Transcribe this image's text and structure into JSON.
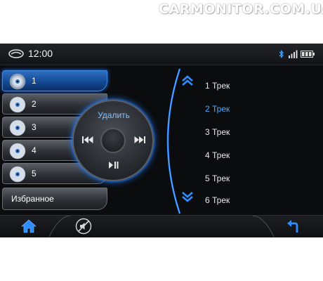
{
  "watermark": "CARMONITOR.COM.UA",
  "status": {
    "time": "12:00"
  },
  "discs": [
    {
      "label": "1",
      "active": true
    },
    {
      "label": "2",
      "active": false
    },
    {
      "label": "3",
      "active": false
    },
    {
      "label": "4",
      "active": false
    },
    {
      "label": "5",
      "active": false
    }
  ],
  "favorites_label": "Избранное",
  "control": {
    "delete_label": "Удалить"
  },
  "tracks": [
    {
      "label": "1 Трек",
      "active": false
    },
    {
      "label": "2 Трек",
      "active": true
    },
    {
      "label": "3 Трек",
      "active": false
    },
    {
      "label": "4 Трек",
      "active": false
    },
    {
      "label": "5 Трек",
      "active": false
    },
    {
      "label": "6 Трек",
      "active": false
    }
  ],
  "icons": {
    "logo": "car-logo-icon",
    "bluetooth": "bluetooth-icon",
    "signal": "signal-icon",
    "battery": "battery-icon",
    "home": "home-icon",
    "mute": "mute-icon",
    "back": "back-arrow-icon",
    "prev": "previous-track-icon",
    "next": "next-track-icon",
    "play_pause": "play-pause-icon",
    "scroll_up": "scroll-up-icon",
    "scroll_down": "scroll-down-icon",
    "disc": "cd-disc-icon"
  },
  "colors": {
    "accent": "#2f8cff",
    "active_text": "#4aa8ff",
    "background": "#0b0c0e"
  }
}
